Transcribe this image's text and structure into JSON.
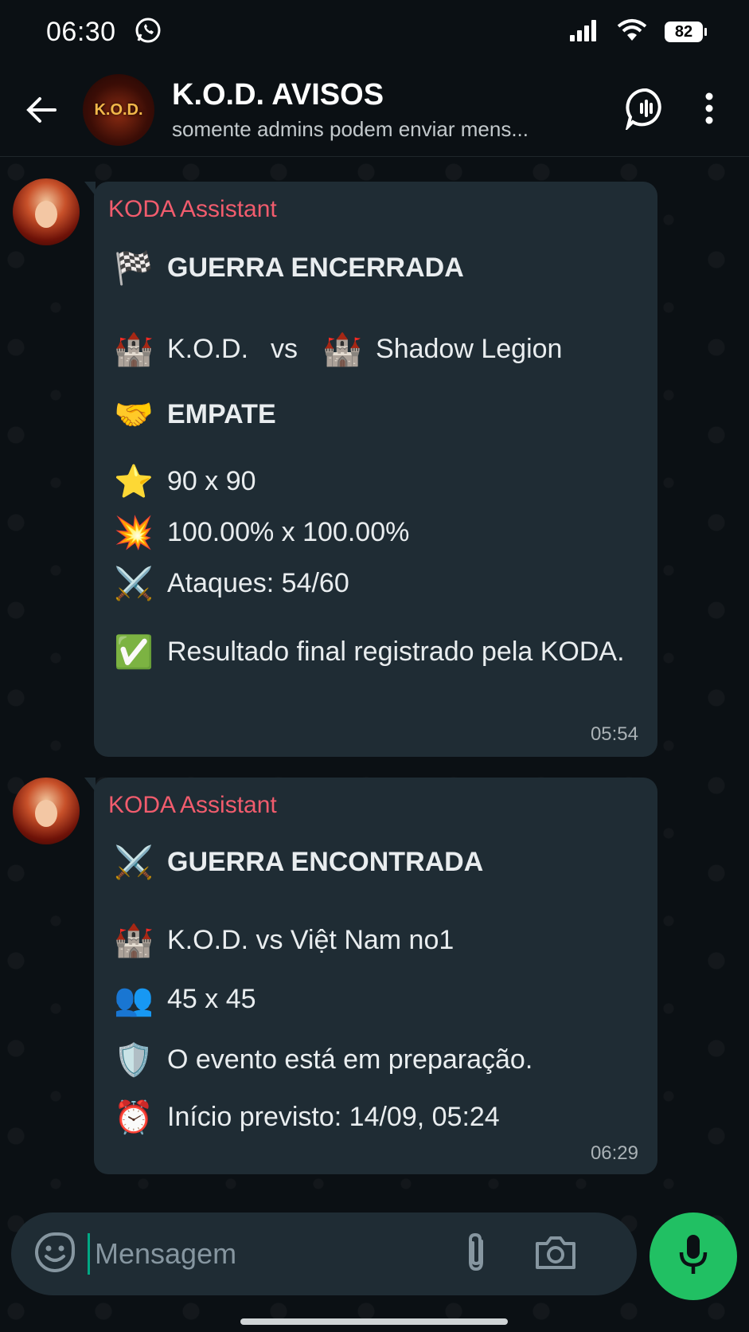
{
  "status_bar": {
    "time": "06:30",
    "battery": "82"
  },
  "header": {
    "group_name": "K.O.D. AVISOS",
    "subtitle": "somente admins podem enviar mens...",
    "avatar_text": "K.O.D."
  },
  "messages": [
    {
      "sender": "KODA Assistant",
      "lines": [
        {
          "icon": "chequered-flag-icon",
          "text": "GUERRA ENCERRADA"
        },
        {
          "icon": "castle-icon",
          "text": "K.O.D.",
          "vs": "vs",
          "icon2": "castle-icon",
          "text2": "Shadow Legion"
        },
        {
          "icon": "handshake-icon",
          "text": "EMPATE"
        },
        {
          "icon": "star-icon",
          "text": "90 x 90"
        },
        {
          "icon": "collision-icon",
          "text": "100.00% x 100.00%"
        },
        {
          "icon": "crossed-swords-icon",
          "text": "Ataques: 54/60"
        },
        {
          "icon": "check-box-icon",
          "text": "Resultado final registrado pela KODA."
        }
      ],
      "time": "05:54"
    },
    {
      "sender": "KODA Assistant",
      "lines": [
        {
          "icon": "crossed-swords-icon",
          "text": "GUERRA ENCONTRADA"
        },
        {
          "icon": "castle-icon",
          "text": "K.O.D. vs Việt Nam no1"
        },
        {
          "icon": "people-icon",
          "text": "45 x 45"
        },
        {
          "icon": "shield-icon",
          "text": "O evento está em preparação."
        },
        {
          "icon": "alarm-clock-icon",
          "text": "Início previsto: 14/09, 05:24"
        }
      ],
      "time": "06:29"
    }
  ],
  "composer": {
    "placeholder": "Mensagem"
  },
  "colors": {
    "accent": "#21c063",
    "sender_name": "#f15c6d",
    "bubble": "#1f2c34",
    "background": "#0b1014"
  }
}
